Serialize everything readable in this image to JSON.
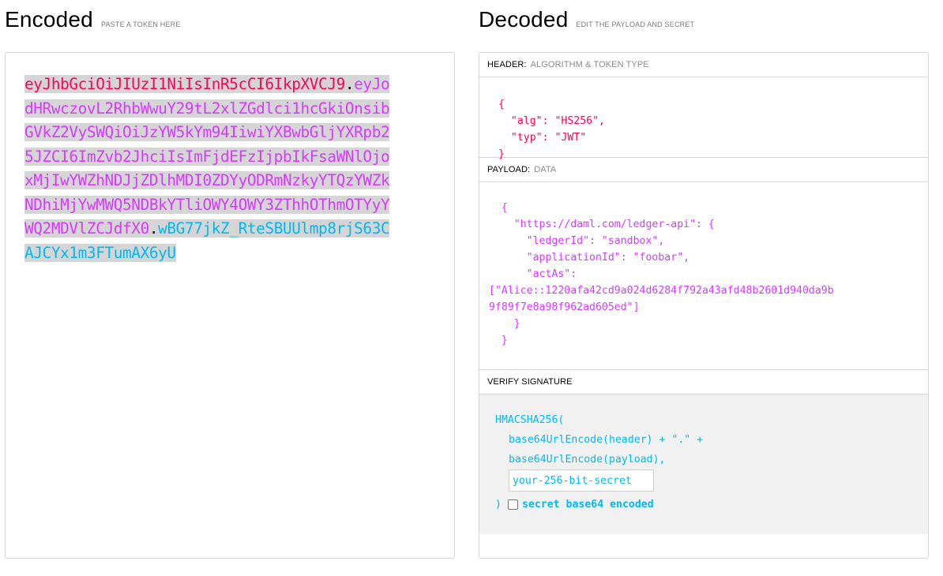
{
  "encoded": {
    "title": "Encoded",
    "hint": "PASTE A TOKEN HERE",
    "token": {
      "header": "eyJhbGciOiJIUzI1NiIsInR5cCI6IkpXVCJ9",
      "dot1": ".",
      "payload": "eyJodHRwczovL2RhbWwuY29tL2xlZGdlci1hcGkiOnsibGVkZ2VySWQiOiJzYW5kYm94IiwiYXBwbGljYXRpb25JZCI6ImZvb2JhciIsImFjdEFzIjpbIkFsaWNlOjoxMjIwYWZhNDJjZDlhMDI0ZDYyODRmNzkyYTQzYWZkNDhiMjYwMWQ5NDBkYTliOWY4OWY3ZThhOThmOTYyYWQ2MDVlZCJdfX0",
      "dot2": ".",
      "signature": "wBG77jkZ_RteSBUUlmp8rjS63CAJCYx1m3FTumAX6yU"
    }
  },
  "decoded": {
    "title": "Decoded",
    "hint": "EDIT THE PAYLOAD AND SECRET",
    "header_section": {
      "label": "HEADER:",
      "sub": "ALGORITHM & TOKEN TYPE",
      "json": "{\n  \"alg\": \"HS256\",\n  \"typ\": \"JWT\"\n}"
    },
    "payload_section": {
      "label": "PAYLOAD:",
      "sub": "DATA",
      "json": "  {\n    \"https://daml.com/ledger-api\": {\n      \"ledgerId\": \"sandbox\",\n      \"applicationId\": \"foobar\",\n      \"actAs\":\n[\"Alice::1220afa42cd9a024d6284f792a43afd48b2601d940da9b\n9f89f7e8a98f962ad605ed\"]\n    }\n  }"
    },
    "verify_section": {
      "label": "VERIFY SIGNATURE",
      "line1": "HMACSHA256(",
      "line2": "base64UrlEncode(header) + \".\" +",
      "line3": "base64UrlEncode(payload),",
      "secret_placeholder": "your-256-bit-secret",
      "close": ")",
      "checkbox_label": "secret base64 encoded"
    }
  },
  "colors": {
    "header": "#fb015b",
    "payload": "#d63aff",
    "signature": "#00b9f1"
  }
}
